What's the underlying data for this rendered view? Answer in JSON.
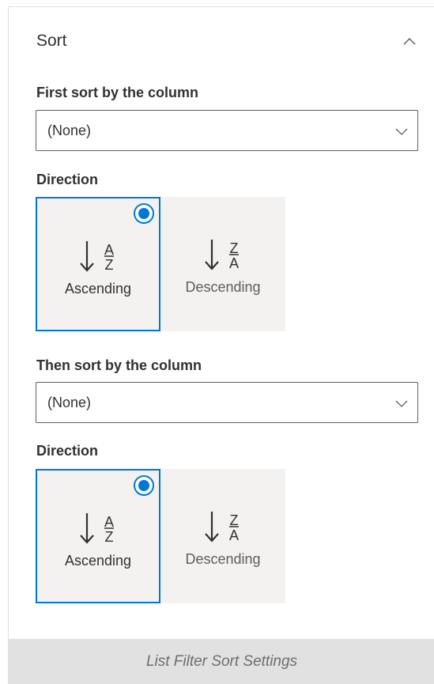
{
  "sort": {
    "title": "Sort",
    "collapse_icon": "chevron-up-icon"
  },
  "first": {
    "label": "First sort by the column",
    "select_value": "(None)",
    "direction_label": "Direction",
    "options": [
      {
        "label": "Ascending",
        "letters_top": "A",
        "letters_bottom": "Z",
        "selected": true
      },
      {
        "label": "Descending",
        "letters_top": "Z",
        "letters_bottom": "A",
        "selected": false
      }
    ]
  },
  "second": {
    "label": "Then sort by the column",
    "select_value": "(None)",
    "direction_label": "Direction",
    "options": [
      {
        "label": "Ascending",
        "letters_top": "A",
        "letters_bottom": "Z",
        "selected": true
      },
      {
        "label": "Descending",
        "letters_top": "Z",
        "letters_bottom": "A",
        "selected": false
      }
    ]
  },
  "caption": "List Filter Sort Settings",
  "colors": {
    "accent": "#0078d4",
    "tile_background": "#f3f2f1",
    "caption_background": "#e1e1e1"
  }
}
